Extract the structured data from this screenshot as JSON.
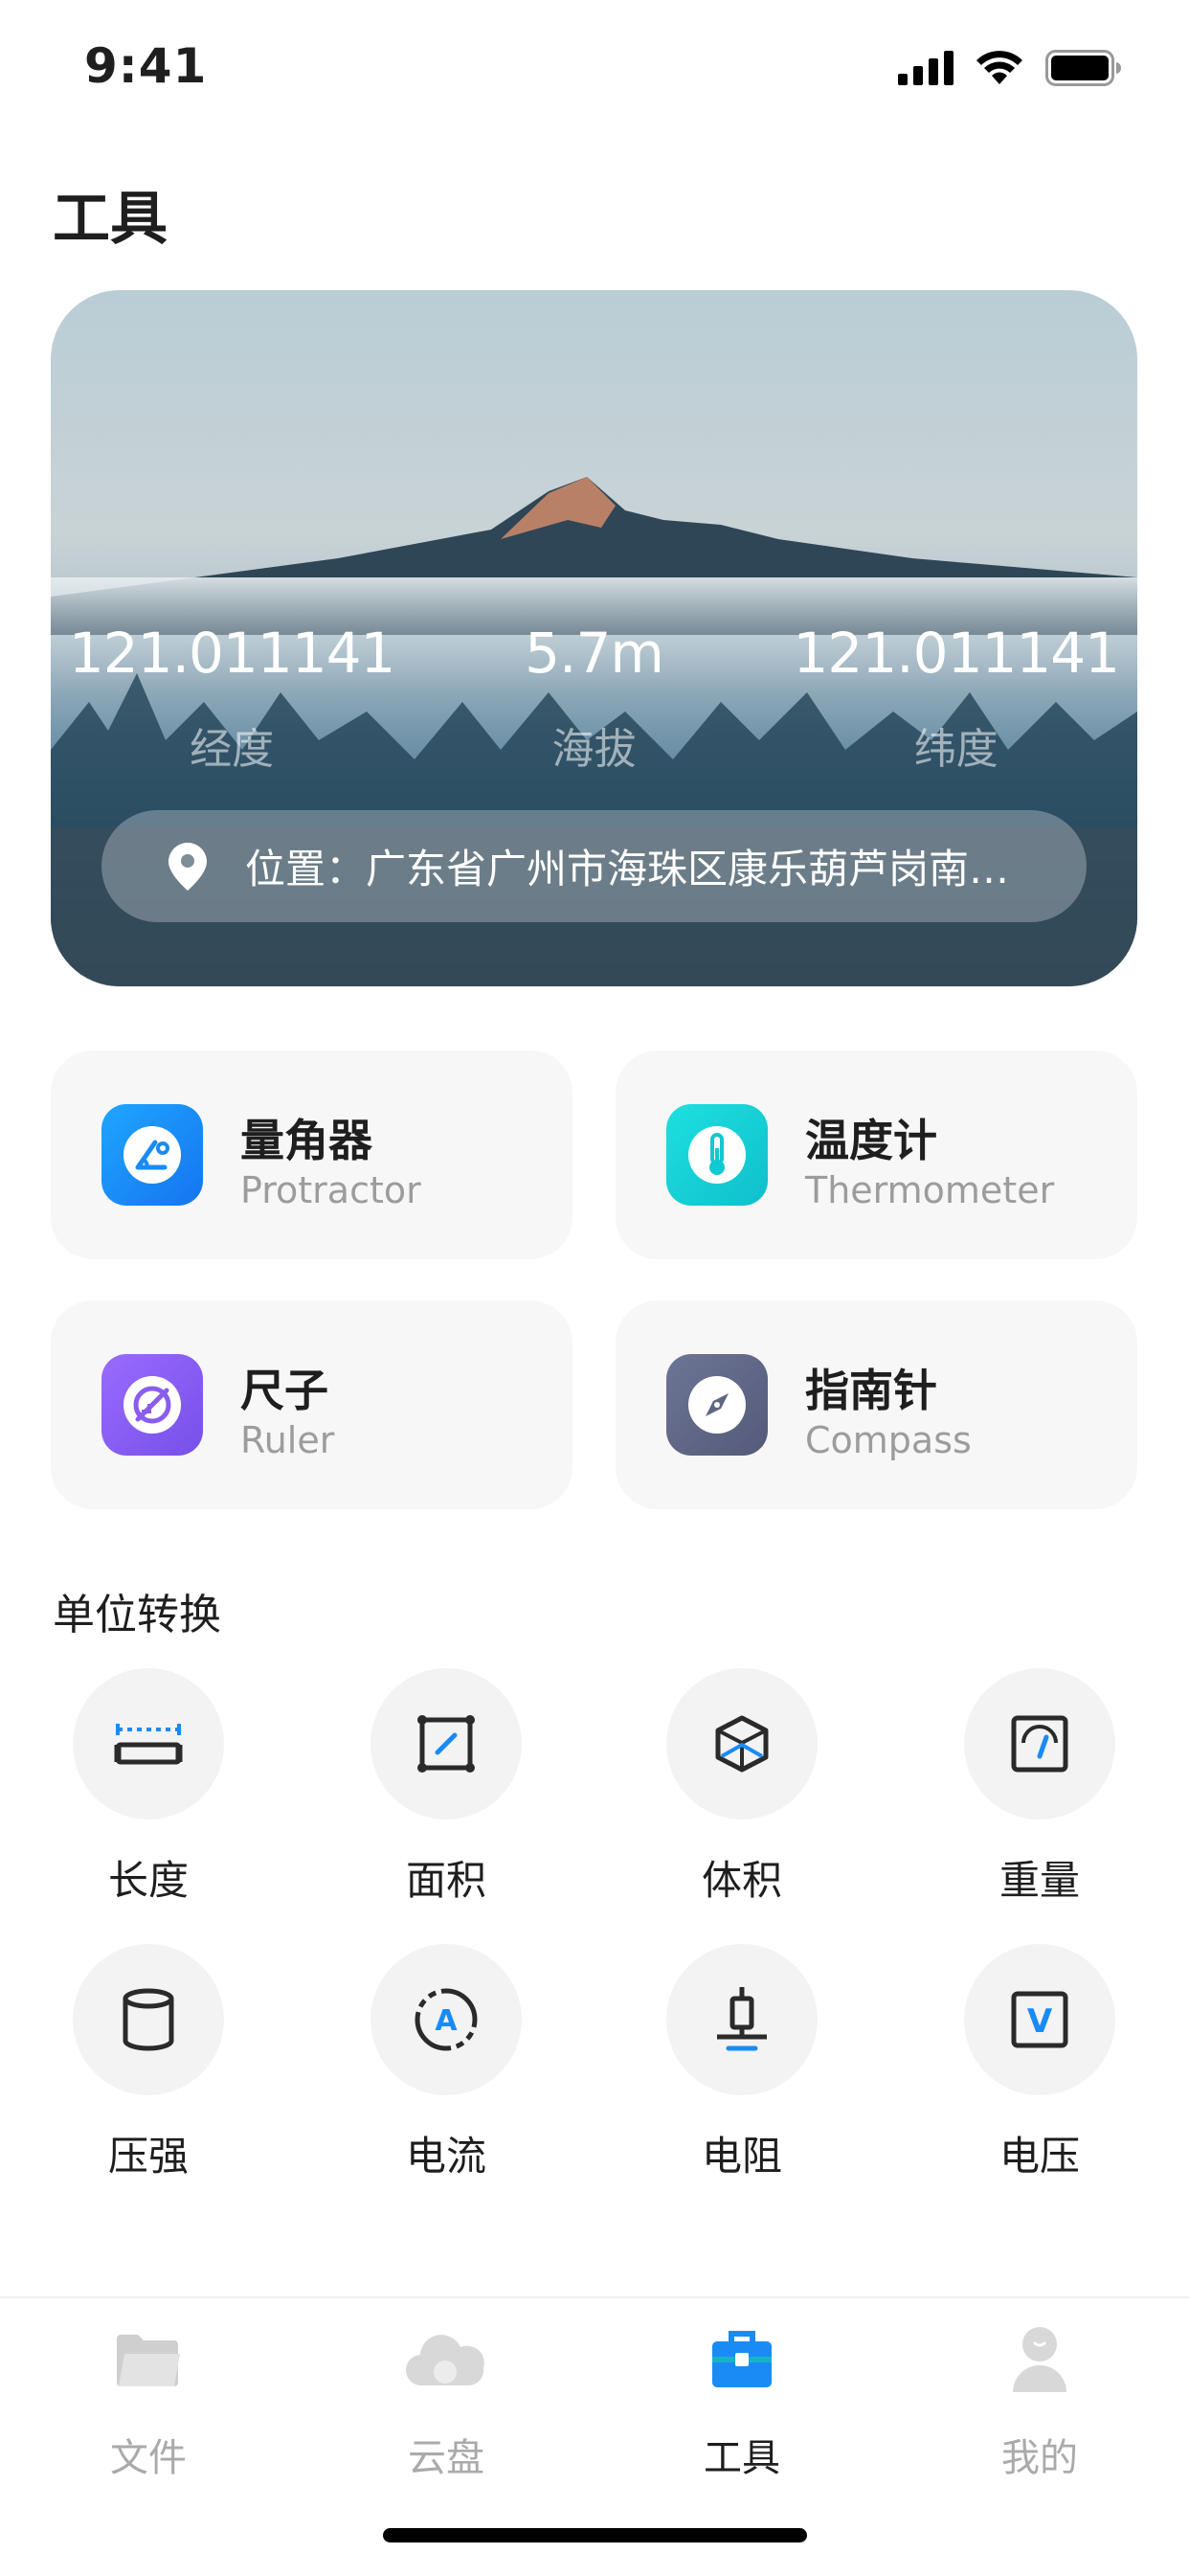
{
  "status_bar": {
    "time": "9:41"
  },
  "page": {
    "title": "工具"
  },
  "hero": {
    "stats": [
      {
        "value": "121.011141",
        "label": "经度"
      },
      {
        "value": "5.7m",
        "label": "海拔"
      },
      {
        "value": "121.011141",
        "label": "纬度"
      }
    ],
    "location": "位置：广东省广州市海珠区康乐葫芦岗南大街"
  },
  "tools": [
    {
      "name": "量角器",
      "subtitle": "Protractor",
      "icon": "protractor-icon",
      "color": "#1a8bf5"
    },
    {
      "name": "温度计",
      "subtitle": "Thermometer",
      "icon": "thermometer-icon",
      "color": "#10c9d2"
    },
    {
      "name": "尺子",
      "subtitle": "Ruler",
      "icon": "ruler-icon",
      "color": "#8a5cf0"
    },
    {
      "name": "指南针",
      "subtitle": "Compass",
      "icon": "compass-icon",
      "color": "#5e6585"
    }
  ],
  "unit_section": {
    "title": "单位转换",
    "items": [
      {
        "label": "长度",
        "icon": "length-icon"
      },
      {
        "label": "面积",
        "icon": "area-icon"
      },
      {
        "label": "体积",
        "icon": "volume-icon"
      },
      {
        "label": "重量",
        "icon": "weight-icon"
      },
      {
        "label": "压强",
        "icon": "pressure-icon"
      },
      {
        "label": "电流",
        "icon": "current-icon"
      },
      {
        "label": "电阻",
        "icon": "resistance-icon"
      },
      {
        "label": "电压",
        "icon": "voltage-icon"
      }
    ]
  },
  "tabbar": {
    "tabs": [
      {
        "label": "文件",
        "icon": "folder-icon"
      },
      {
        "label": "云盘",
        "icon": "cloud-icon"
      },
      {
        "label": "工具",
        "icon": "toolbox-icon",
        "active": true
      },
      {
        "label": "我的",
        "icon": "user-icon"
      }
    ],
    "active_color": "#1a8bf5",
    "inactive_color": "#cfcfcf"
  }
}
